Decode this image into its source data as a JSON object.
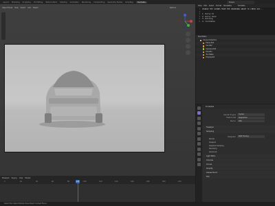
{
  "topbar": {
    "workspaces": [
      "Layout",
      "Modeling",
      "Sculpting",
      "UV Editing",
      "Texture Paint",
      "Shading",
      "Animation",
      "Rendering",
      "Compositing",
      "Geometry Nodes",
      "Scripting",
      "Turntable"
    ],
    "active_workspace": "Turntable",
    "scene": "Scene"
  },
  "viewport": {
    "header": [
      "Object Mode",
      "View",
      "Select",
      "Add",
      "Object"
    ],
    "options": "Options"
  },
  "text_editor": {
    "header": [
      "View",
      "Edit",
      "Select",
      "Format",
      "Templates"
    ],
    "file": "Turntable",
    "lines": [
      {
        "n": "1",
        "t": "CHANGE THE SCENES FROM THE DROPDOWN ABOVE TO CHECK OUT..."
      },
      {
        "n": "2",
        "t": ""
      },
      {
        "n": "3",
        "t": "1. Dolly In"
      },
      {
        "n": "4",
        "t": "2. Dolly Zoom"
      },
      {
        "n": "5",
        "t": "3. Rolling"
      },
      {
        "n": "6",
        "t": "4. Turntable"
      }
    ]
  },
  "outliner": {
    "title": "Text Editor",
    "rows": [
      {
        "label": "Scene Collection",
        "kind": "col"
      },
      {
        "label": "Plane.001",
        "kind": "obj"
      },
      {
        "label": "Car.002",
        "kind": "obj"
      },
      {
        "label": "Camera.003",
        "kind": "cam"
      },
      {
        "label": "ISO.001",
        "kind": "obj"
      },
      {
        "label": "TurnTable",
        "kind": "obj"
      },
      {
        "label": "Empty.003",
        "kind": "obj"
      }
    ]
  },
  "properties": {
    "scene_title": "Turntable",
    "render_engine_label": "Render Engine",
    "render_engine": "Cycles",
    "feature_set_label": "Feature Set",
    "feature_set": "Supported",
    "device_label": "Device",
    "device": "CPU",
    "sampling_panel": "Sampling",
    "integrator_label": "Integrator",
    "integrator": "Path Tracing",
    "render_label": "Render",
    "viewport_label": "Viewport",
    "adaptive_label": "Adaptive Sampling",
    "denoising": "Denoising",
    "advanced": "Advanced",
    "light_paths": "Light Paths",
    "volumes": "Volumes",
    "hair": "Curves",
    "simplify": "Simplify",
    "grease_pencil": "Grease Pencil",
    "film": "Film",
    "freestyle": "Freestyle"
  },
  "timeline": {
    "header": [
      "Playback",
      "Keying",
      "View",
      "Marker"
    ],
    "ticks": [
      "0",
      "20",
      "40",
      "60",
      "80",
      "100",
      "120",
      "140",
      "160",
      "180",
      "200",
      "220"
    ],
    "current_frame": "120"
  },
  "status": "Select  Box Select  Rotate View  Object Context Menu"
}
